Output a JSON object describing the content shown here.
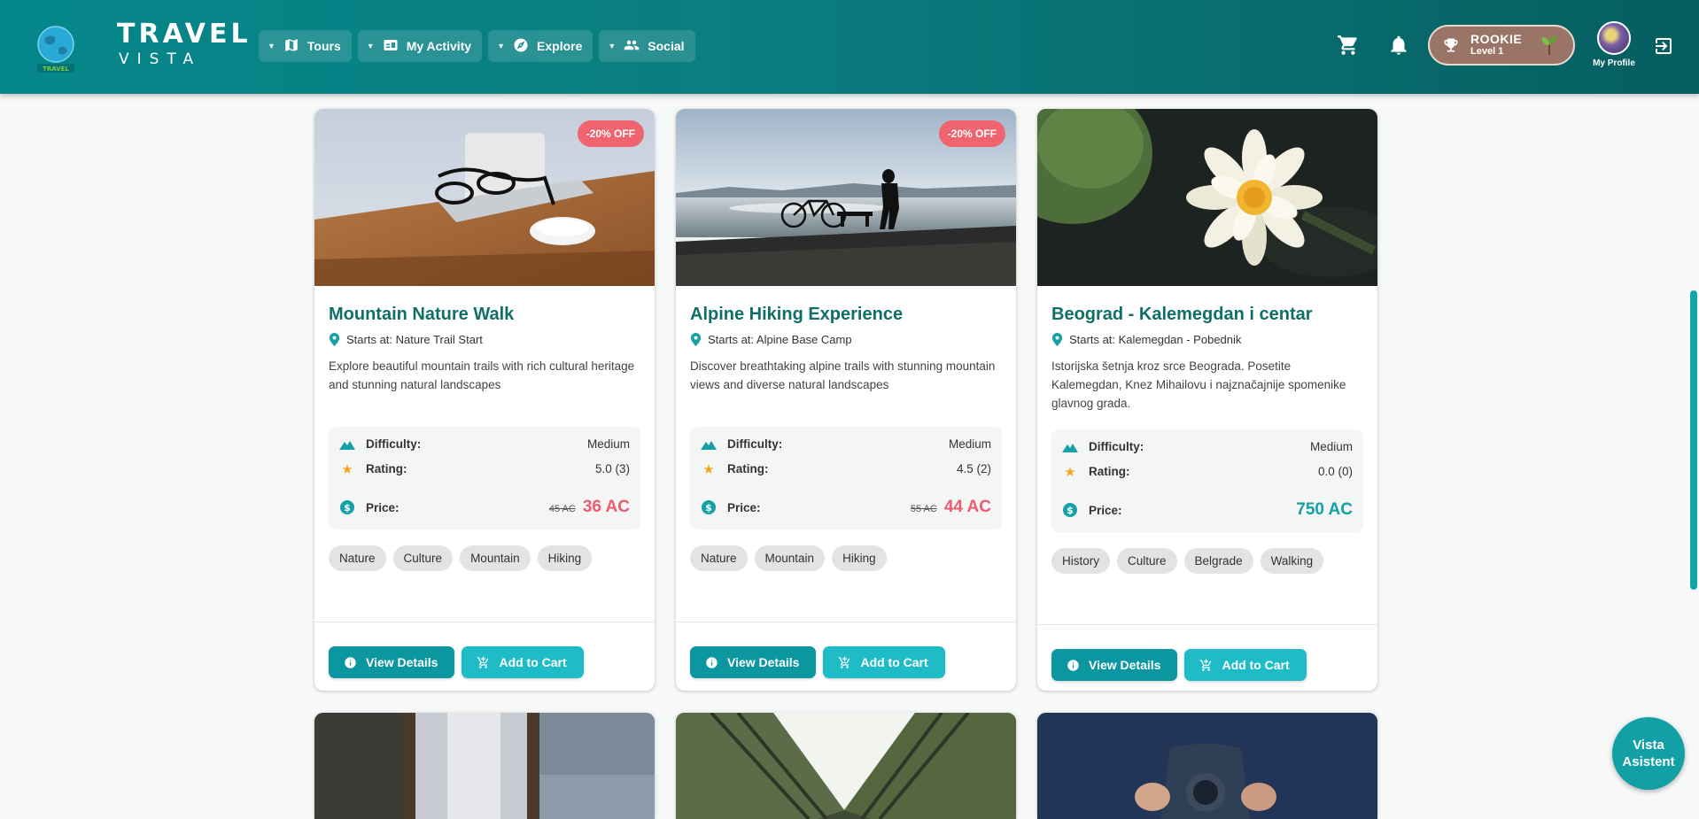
{
  "brand": {
    "title": "TRAVEL",
    "subtitle": "VISTA",
    "logo_icon": "globe-logo",
    "logo_text": "TRAVEL"
  },
  "nav": [
    {
      "label": "Tours",
      "icon": "map-icon"
    },
    {
      "label": "My Activity",
      "icon": "activity-icon"
    },
    {
      "label": "Explore",
      "icon": "compass-icon"
    },
    {
      "label": "Social",
      "icon": "people-icon"
    }
  ],
  "header": {
    "cart_icon": "cart-icon",
    "bell_icon": "bell-icon",
    "rank": {
      "name": "ROOKIE",
      "level": "Level 1"
    },
    "profile_label": "My Profile",
    "logout_icon": "logout-icon"
  },
  "labels": {
    "difficulty": "Difficulty:",
    "rating": "Rating:",
    "price": "Price:",
    "view_details": "View Details",
    "add_to_cart": "Add to Cart"
  },
  "tours": [
    {
      "title": "Mountain Nature Walk",
      "start": "Starts at: Nature Trail Start",
      "description": "Explore beautiful mountain trails with rich cultural heritage and stunning natural landscapes",
      "difficulty": "Medium",
      "rating": "5.0 (3)",
      "old_price": "45 AC",
      "price": "36 AC",
      "discount": "-20% OFF",
      "tags": [
        "Nature",
        "Culture",
        "Mountain",
        "Hiking"
      ]
    },
    {
      "title": "Alpine Hiking Experience",
      "start": "Starts at: Alpine Base Camp",
      "description": "Discover breathtaking alpine trails with stunning mountain views and diverse natural landscapes",
      "difficulty": "Medium",
      "rating": "4.5 (2)",
      "old_price": "55 AC",
      "price": "44 AC",
      "discount": "-20% OFF",
      "tags": [
        "Nature",
        "Mountain",
        "Hiking"
      ]
    },
    {
      "title": "Beograd - Kalemegdan i centar",
      "start": "Starts at: Kalemegdan - Pobednik",
      "description": "Istorijska šetnja kroz srce Beograda. Posetite Kalemegdan, Knez Mihailovu i najznačajnije spomenike glavnog grada.",
      "difficulty": "Medium",
      "rating": "0.0 (0)",
      "price": "750 AC",
      "tags": [
        "History",
        "Culture",
        "Belgrade",
        "Walking"
      ]
    }
  ],
  "assistant": {
    "line1": "Vista",
    "line2": "Asistent"
  },
  "colors": {
    "header": "#05878a",
    "title": "#0f6f68",
    "accent": "#13a0a6",
    "discount": "#f06470",
    "sale_price": "#ec5c70"
  }
}
